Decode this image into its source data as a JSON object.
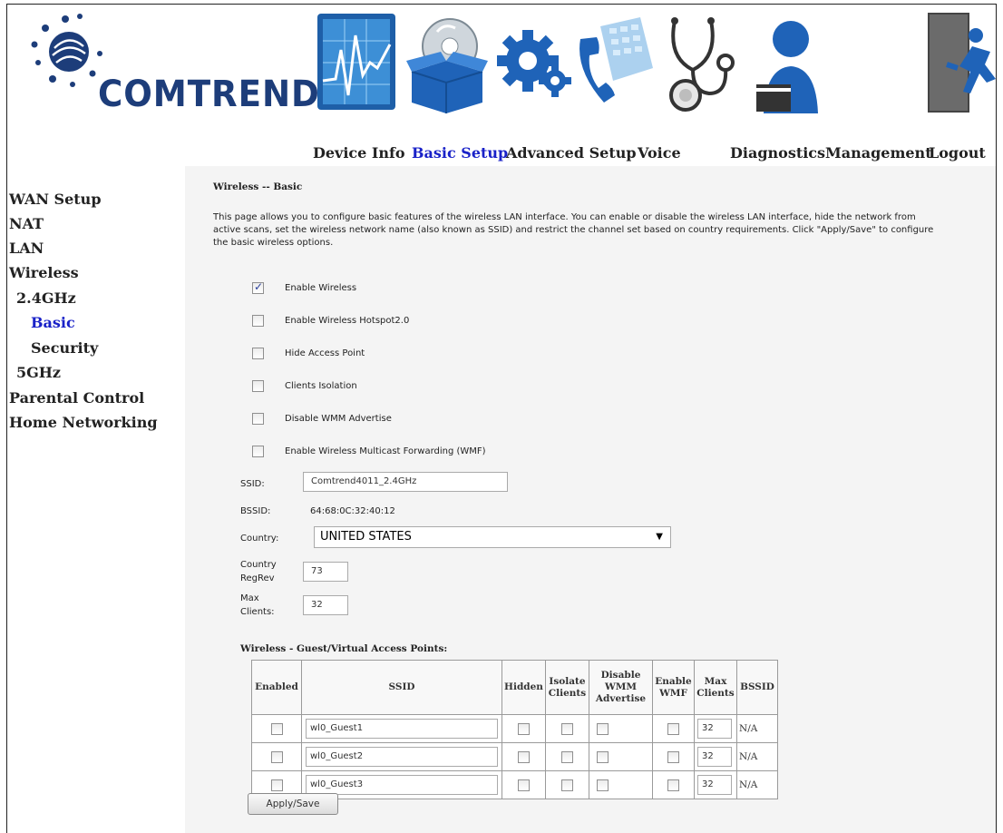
{
  "brand": {
    "name": "COMTREND",
    "color": "#1d3d7a"
  },
  "nav": {
    "items": [
      {
        "label": "Device Info",
        "icon": "device-info-chart-icon",
        "active": false
      },
      {
        "label": "Basic Setup",
        "icon": "basic-setup-box-icon",
        "active": true
      },
      {
        "label": "Advanced Setup",
        "icon": "advanced-setup-gears-icon",
        "active": false
      },
      {
        "label": "Voice",
        "icon": "voice-phone-icon",
        "active": false
      },
      {
        "label": "Diagnostics",
        "icon": "diagnostics-stethoscope-icon",
        "active": false
      },
      {
        "label": "Management",
        "icon": "management-user-icon",
        "active": false
      },
      {
        "label": "Logout",
        "icon": "logout-door-icon",
        "active": false
      }
    ],
    "active_color": "#1a22c8"
  },
  "sidebar": {
    "items": [
      {
        "label": "WAN Setup"
      },
      {
        "label": "NAT"
      },
      {
        "label": "LAN"
      },
      {
        "label": "Wireless"
      },
      {
        "label": "2.4GHz"
      },
      {
        "label": "Basic",
        "active": true
      },
      {
        "label": "Security"
      },
      {
        "label": "5GHz"
      },
      {
        "label": "Parental Control"
      },
      {
        "label": "Home Networking"
      }
    ]
  },
  "page": {
    "title": "Wireless -- Basic",
    "intro": "This page allows you to configure basic features of the wireless LAN interface. You can enable or disable the wireless LAN interface, hide the network from active scans, set the wireless network name (also known as SSID) and restrict the channel set based on country requirements. Click \"Apply/Save\" to configure the basic wireless options.",
    "options": [
      {
        "label": "Enable Wireless",
        "checked": true
      },
      {
        "label": "Enable Wireless Hotspot2.0",
        "checked": false
      },
      {
        "label": "Hide Access Point",
        "checked": false
      },
      {
        "label": "Clients Isolation",
        "checked": false
      },
      {
        "label": "Disable WMM Advertise",
        "checked": false
      },
      {
        "label": "Enable Wireless Multicast Forwarding (WMF)",
        "checked": false
      }
    ],
    "ssid": {
      "label": "SSID:",
      "value": "Comtrend4011_2.4GHz"
    },
    "bssid": {
      "label": "BSSID:",
      "value": "64:68:0C:32:40:12"
    },
    "country": {
      "label": "Country:",
      "value": "UNITED STATES"
    },
    "regrev": {
      "label_line1": "Country",
      "label_line2": "RegRev",
      "value": "73"
    },
    "max_clients": {
      "label_line1": "Max",
      "label_line2": "Clients:",
      "value": "32"
    },
    "guest_heading": "Wireless - Guest/Virtual Access Points:",
    "guest_table": {
      "headers": [
        "Enabled",
        "SSID",
        "Hidden",
        "Isolate Clients",
        "Disable WMM Advertise",
        "Enable WMF",
        "Max Clients",
        "BSSID"
      ],
      "rows": [
        {
          "ssid": "wl0_Guest1",
          "max_clients": "32",
          "bssid": "N/A"
        },
        {
          "ssid": "wl0_Guest2",
          "max_clients": "32",
          "bssid": "N/A"
        },
        {
          "ssid": "wl0_Guest3",
          "max_clients": "32",
          "bssid": "N/A"
        }
      ]
    },
    "apply_label": "Apply/Save"
  }
}
